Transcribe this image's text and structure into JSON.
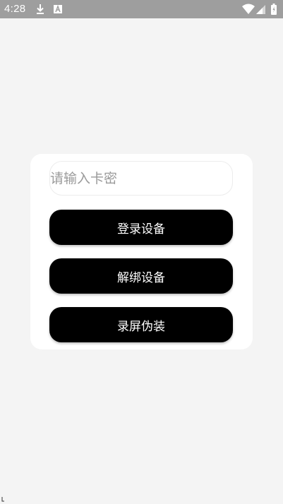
{
  "status_bar": {
    "time": "4:28",
    "icons": [
      "download-icon",
      "font-a-icon",
      "wifi-icon",
      "signal-icon",
      "battery-icon"
    ]
  },
  "card": {
    "card_password": {
      "placeholder": "请输入卡密",
      "value": ""
    },
    "buttons": {
      "login_label": "登录设备",
      "unbind_label": "解绑设备",
      "disguise_label": "录屏伪装"
    }
  },
  "colors": {
    "background": "#f4f4f4",
    "status_bar": "#9e9e9e",
    "card": "#ffffff",
    "button": "#000000",
    "button_text": "#ffffff",
    "placeholder": "#9a9a9a"
  }
}
